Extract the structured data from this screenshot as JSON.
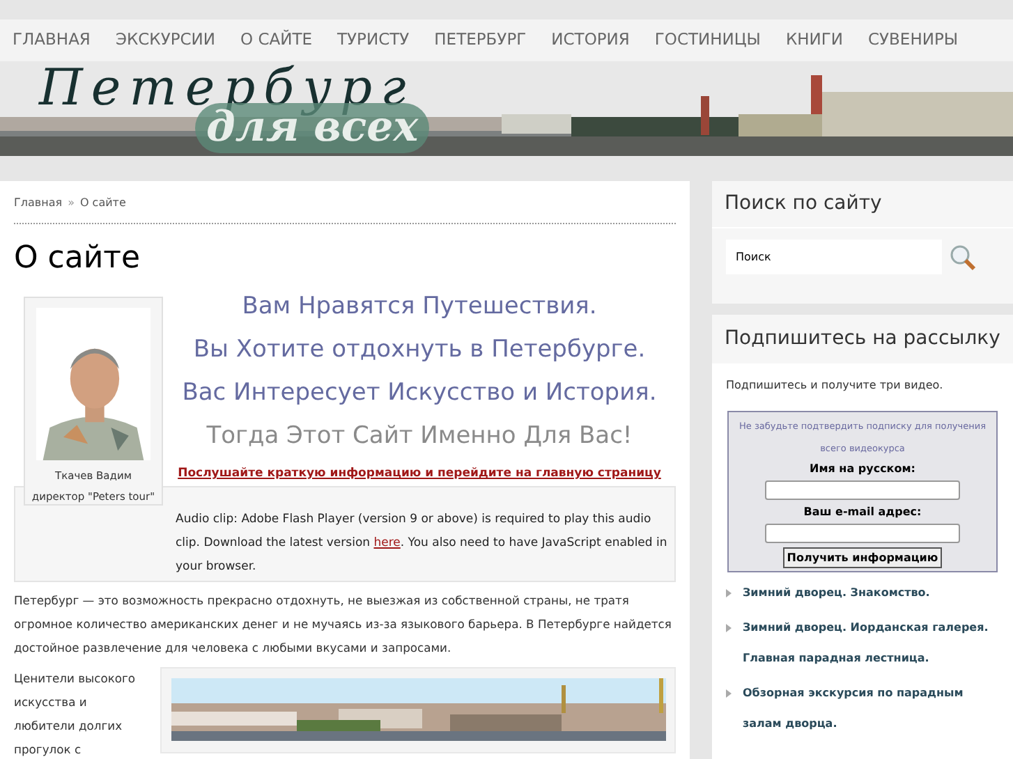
{
  "nav": [
    {
      "label": "ГЛАВНАЯ"
    },
    {
      "label": "ЭКСКУРСИИ"
    },
    {
      "label": "О САЙТЕ"
    },
    {
      "label": "ТУРИСТУ"
    },
    {
      "label": "ПЕТЕРБУРГ"
    },
    {
      "label": "ИСТОРИЯ"
    },
    {
      "label": "ГОСТИНИЦЫ"
    },
    {
      "label": "КНИГИ"
    },
    {
      "label": "СУВЕНИРЫ"
    }
  ],
  "banner": {
    "title": "Петербург",
    "subtitle": "для всех"
  },
  "breadcrumb": [
    {
      "label": "Главная",
      "kind": "link"
    },
    {
      "label": "»",
      "kind": "sep"
    },
    {
      "label": "О сайте",
      "kind": "current"
    }
  ],
  "page_title": "О сайте",
  "author": {
    "name": "Ткачев Вадим",
    "role": "директор \"Peters tour\""
  },
  "slogans": [
    {
      "text": "Вам Нравятся Путешествия.",
      "kind": "accent"
    },
    {
      "text": "Вы Хотите отдохнуть в Петербурге.",
      "kind": "accent"
    },
    {
      "text": "Вас Интересует Искусство и История.",
      "kind": "accent"
    },
    {
      "text": "Тогда Этот Сайт Именно Для Вас!",
      "kind": "muted"
    }
  ],
  "listen_link": "Послушайте краткую информацию и перейдите на главную страницу",
  "audio_notice": {
    "before": "Audio clip: Adobe Flash Player (version 9 or above) is required to play this audio clip. Download the latest version ",
    "link": "here",
    "after": ". You also need to have JavaScript enabled in your browser."
  },
  "intro": "Петербург — это возможность прекрасно отдохнуть, не выезжая из собственной страны,  не тратя огромное количество американских денег и не мучаясь из-за языкового барьера. В Петербурге найдется достойное развлечение для человека с любыми вкусами и запросами.",
  "side_text": "Ценители высокого искусства и любители долгих прогулок с",
  "search": {
    "title": "Поиск по сайту",
    "value": "Поиск"
  },
  "subscribe": {
    "title": "Подпишитесь на рассылку",
    "intro": "Подпишитесь и получите три видео.",
    "notice": "Не забудьте подтвердить подписку для получения всего видеокурса",
    "name_label": "Имя на русском:",
    "email_label": "Ваш e-mail адрес:",
    "button": "Получить информацию"
  },
  "links": [
    {
      "label": "Зимний дворец. Знакомство."
    },
    {
      "label": "Зимний дворец. Иорданская галерея. Главная парадная лестница."
    },
    {
      "label": "Обзорная экскурсия по парадным залам дворца."
    }
  ]
}
